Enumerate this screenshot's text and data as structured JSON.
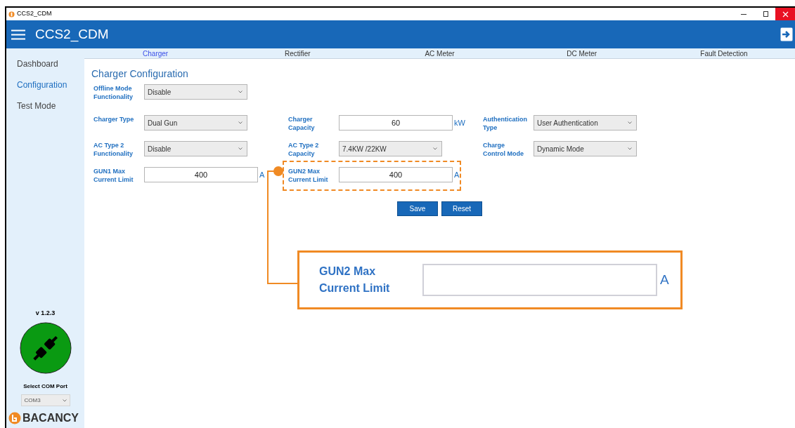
{
  "window": {
    "title": "CCS2_CDM"
  },
  "header": {
    "title": "CCS2_CDM"
  },
  "sidebar": {
    "items": [
      {
        "label": "Dashboard",
        "selected": false
      },
      {
        "label": "Configuration",
        "selected": true
      },
      {
        "label": "Test Mode",
        "selected": false
      }
    ],
    "version": "v 1.2.3",
    "com_port_label": "Select COM Port",
    "com_port": "COM3",
    "brand": "BACANCY"
  },
  "tabs": [
    {
      "label": "Charger",
      "selected": true
    },
    {
      "label": "Rectifier",
      "selected": false
    },
    {
      "label": "AC Meter",
      "selected": false
    },
    {
      "label": "DC Meter",
      "selected": false
    },
    {
      "label": "Fault Detection",
      "selected": false
    }
  ],
  "page_title": "Charger Configuration",
  "rows": [
    [
      {
        "kind": "select",
        "label": "Offline Mode\nFunctionality",
        "value": "Disable"
      }
    ],
    [
      {
        "kind": "select",
        "label": "Charger Type",
        "value": "Dual Gun"
      },
      {
        "kind": "input",
        "label": "Charger\nCapacity",
        "value": "60",
        "unit": "kW"
      },
      {
        "kind": "select",
        "label": "Authentication\nType",
        "value": "User Authentication"
      }
    ],
    [
      {
        "kind": "select",
        "label": "AC Type 2\nFunctionality",
        "value": "Disable"
      },
      {
        "kind": "select",
        "label": "AC Type 2\nCapacity",
        "value": "7.4KW /22KW"
      },
      {
        "kind": "select",
        "label": "Charge\nControl Mode",
        "value": "Dynamic Mode"
      }
    ],
    [
      {
        "kind": "input",
        "label": "GUN1 Max\nCurrent Limit",
        "value": "400",
        "unit": "A"
      },
      {
        "kind": "input",
        "label": "GUN2 Max\nCurrent Limit",
        "value": "400",
        "unit": "A",
        "highlighted": true
      }
    ]
  ],
  "buttons": [
    "Save",
    "Reset"
  ],
  "callout": {
    "label": "GUN2 Max\nCurrent Limit",
    "unit": "A"
  }
}
